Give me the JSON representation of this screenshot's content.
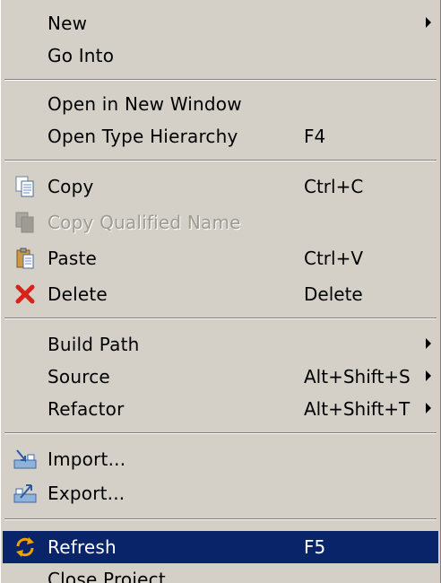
{
  "menu": {
    "new": {
      "label": "New"
    },
    "go_into": {
      "label": "Go Into"
    },
    "open_new_window": {
      "label": "Open in New Window"
    },
    "open_type_hierarchy": {
      "label": "Open Type Hierarchy",
      "shortcut": "F4"
    },
    "copy": {
      "label": "Copy",
      "shortcut": "Ctrl+C",
      "icon": "copy-icon"
    },
    "copy_qualified": {
      "label": "Copy Qualified Name",
      "icon": "copy-qualified-name-icon"
    },
    "paste": {
      "label": "Paste",
      "shortcut": "Ctrl+V",
      "icon": "paste-icon"
    },
    "delete": {
      "label": "Delete",
      "shortcut": "Delete",
      "icon": "delete-icon"
    },
    "build_path": {
      "label": "Build Path"
    },
    "source": {
      "label": "Source",
      "shortcut": "Alt+Shift+S"
    },
    "refactor": {
      "label": "Refactor",
      "shortcut": "Alt+Shift+T"
    },
    "import": {
      "label": "Import...",
      "icon": "import-icon"
    },
    "export": {
      "label": "Export...",
      "icon": "export-icon"
    },
    "refresh": {
      "label": "Refresh",
      "shortcut": "F5",
      "icon": "refresh-icon"
    },
    "close_project": {
      "label": "Close Project"
    }
  },
  "colors": {
    "menu_bg": "#d4d0c8",
    "highlight_bg": "#0a246a",
    "highlight_text": "#ffffff",
    "disabled_text": "#9d9a92"
  }
}
